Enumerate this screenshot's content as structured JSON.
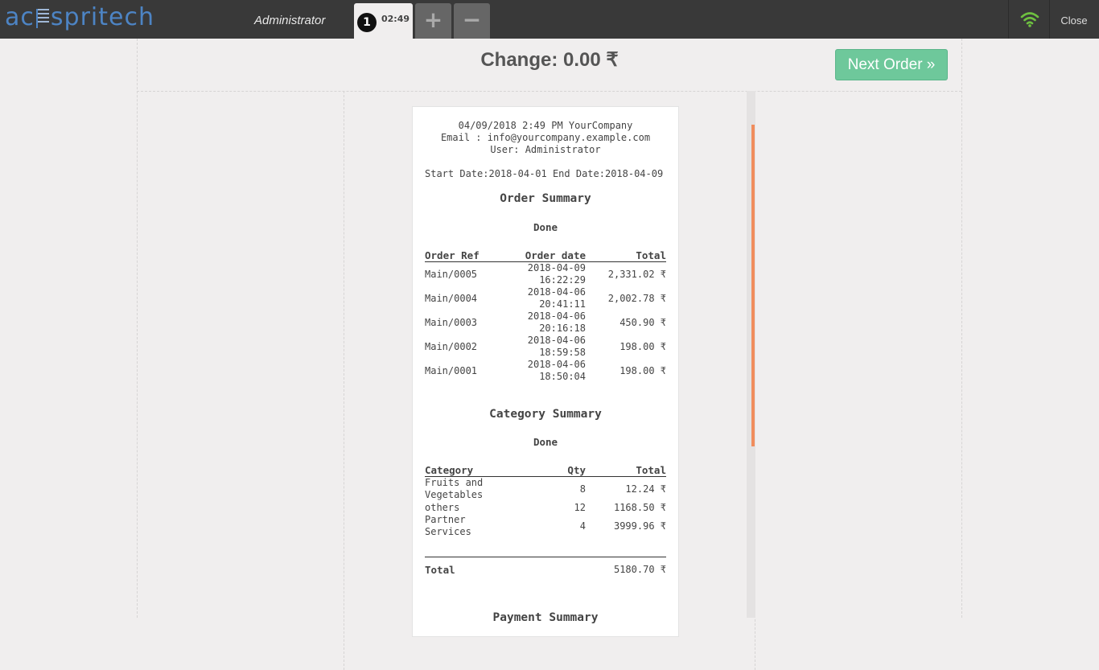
{
  "header": {
    "logo_prefix": "ac",
    "logo_suffix": "spritech",
    "user": "Administrator",
    "order_tab": {
      "number": "1",
      "time": "02:49"
    },
    "add_label": "+",
    "remove_label": "−",
    "close_label": "Close",
    "wifi_color": "#6ec040"
  },
  "payment": {
    "change_label": "Change: 0.00 ₹",
    "next_order_label": "Next Order »"
  },
  "receipt": {
    "header_lines": [
      "04/09/2018 2:49 PM YourCompany",
      "Email : info@yourcompany.example.com",
      "User: Administrator"
    ],
    "date_range": "Start Date:2018-04-01 End Date:2018-04-09",
    "order_summary": {
      "title": "Order Summary",
      "state": "Done",
      "columns": [
        "Order Ref",
        "Order date",
        "Total"
      ],
      "rows": [
        {
          "ref": "Main/0005",
          "date": "2018-04-09",
          "time": "16:22:29",
          "total": "2,331.02 ₹"
        },
        {
          "ref": "Main/0004",
          "date": "2018-04-06",
          "time": "20:41:11",
          "total": "2,002.78 ₹"
        },
        {
          "ref": "Main/0003",
          "date": "2018-04-06",
          "time": "20:16:18",
          "total": "450.90 ₹"
        },
        {
          "ref": "Main/0002",
          "date": "2018-04-06",
          "time": "18:59:58",
          "total": "198.00 ₹"
        },
        {
          "ref": "Main/0001",
          "date": "2018-04-06",
          "time": "18:50:04",
          "total": "198.00 ₹"
        }
      ]
    },
    "category_summary": {
      "title": "Category Summary",
      "state": "Done",
      "columns": [
        "Category",
        "Qty",
        "Total"
      ],
      "rows": [
        {
          "name_lines": [
            "Fruits and",
            "Vegetables"
          ],
          "qty": "8",
          "total": "12.24 ₹"
        },
        {
          "name_lines": [
            "others"
          ],
          "qty": "12",
          "total": "1168.50 ₹"
        },
        {
          "name_lines": [
            "Partner",
            "Services"
          ],
          "qty": "4",
          "total": "3999.96 ₹"
        }
      ],
      "total_label": "Total",
      "total_value": "5180.70 ₹"
    },
    "next_section_title": "Payment Summary"
  }
}
